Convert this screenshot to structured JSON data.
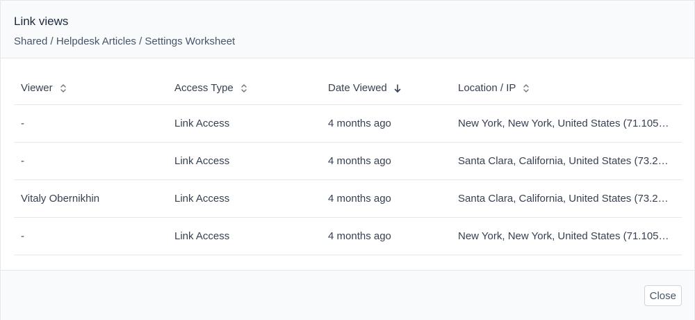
{
  "modal": {
    "title": "Link views",
    "breadcrumb": "Shared / Helpdesk Articles / Settings Worksheet"
  },
  "table": {
    "columns": [
      {
        "label": "Viewer",
        "sort_icon": "sort-unsorted-icon"
      },
      {
        "label": "Access Type",
        "sort_icon": "sort-unsorted-icon"
      },
      {
        "label": "Date Viewed",
        "sort_icon": "sort-descending-arrow-icon"
      },
      {
        "label": "Location / IP",
        "sort_icon": "sort-unsorted-icon"
      }
    ],
    "rows": [
      {
        "viewer": "-",
        "access_type": "Link Access",
        "date_viewed": "4 months ago",
        "location": "New York, New York, United States (71.105…"
      },
      {
        "viewer": "-",
        "access_type": "Link Access",
        "date_viewed": "4 months ago",
        "location": "Santa Clara, California, United States (73.2…"
      },
      {
        "viewer": "Vitaly Obernikhin",
        "access_type": "Link Access",
        "date_viewed": "4 months ago",
        "location": "Santa Clara, California, United States (73.2…"
      },
      {
        "viewer": "-",
        "access_type": "Link Access",
        "date_viewed": "4 months ago",
        "location": "New York, New York, United States (71.105…"
      }
    ]
  },
  "footer": {
    "close_label": "Close"
  },
  "colors": {
    "header_bg": "#f8fafc",
    "border": "#e5e7eb",
    "text": "#374151"
  }
}
